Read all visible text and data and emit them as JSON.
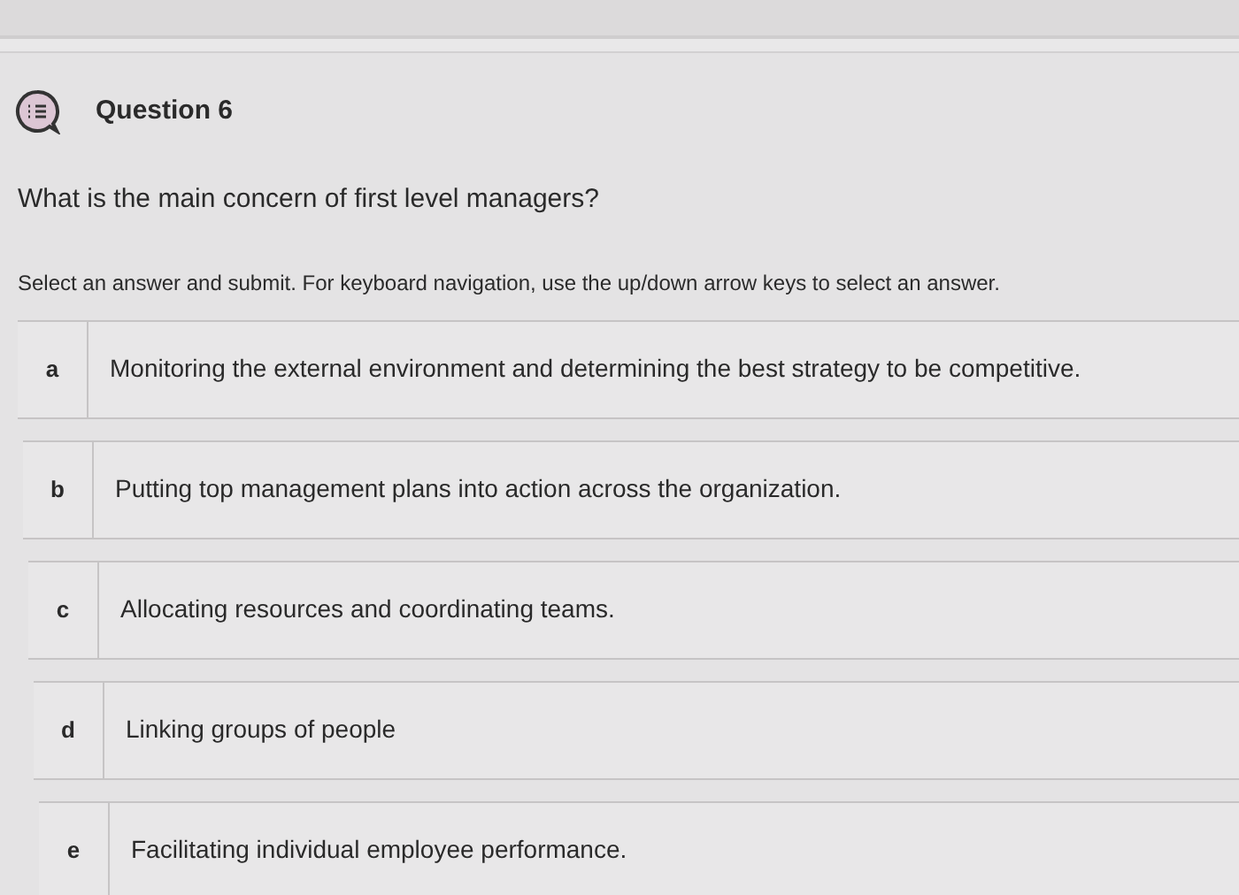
{
  "question": {
    "title": "Question 6",
    "text": "What is the main concern of first level managers?",
    "instructions": "Select an answer and submit. For keyboard navigation, use the up/down arrow keys to select an answer."
  },
  "options": [
    {
      "letter": "a",
      "text": "Monitoring the external environment and determining the best strategy to be competitive."
    },
    {
      "letter": "b",
      "text": "Putting top management plans into action across the organization."
    },
    {
      "letter": "c",
      "text": "Allocating resources and coordinating teams."
    },
    {
      "letter": "d",
      "text": "Linking groups of people"
    },
    {
      "letter": "e",
      "text": "Facilitating individual employee performance."
    }
  ]
}
